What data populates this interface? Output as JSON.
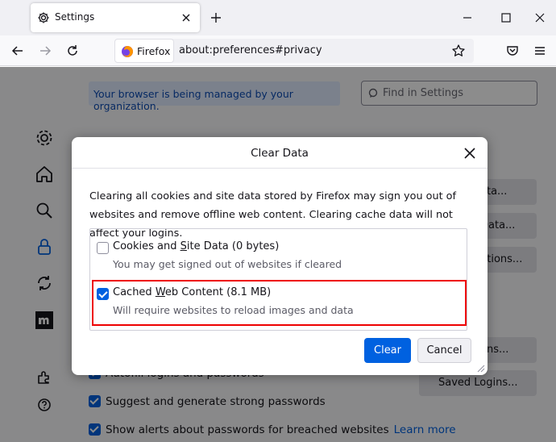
{
  "tab": {
    "title": "Settings",
    "icon": "gear-icon"
  },
  "window_controls": [
    "minimize-icon",
    "maximize-icon",
    "close-icon"
  ],
  "nav": {
    "identity_label": "Firefox",
    "url": "about:preferences#privacy"
  },
  "page": {
    "managed_notice": "Your browser is being managed by your organization.",
    "find_placeholder": "Find in Settings",
    "sidebar_icons": [
      "gear-icon",
      "home-icon",
      "search-icon",
      "lock-icon",
      "sync-icon",
      "mozilla-icon",
      "extensions-icon",
      "help-icon"
    ],
    "right_buttons": [
      "ata...",
      "Data...",
      "ptions...",
      "ons...",
      "Saved Logins..."
    ],
    "checkbox_rows": [
      {
        "label": "Autofill logins and passwords"
      },
      {
        "label": "Suggest and generate strong passwords"
      },
      {
        "label": "Show alerts about passwords for breached websites",
        "link": "Learn more"
      }
    ]
  },
  "dialog": {
    "title": "Clear Data",
    "description": "Clearing all cookies and site data stored by Firefox may sign you out of websites and remove offline web content. Clearing cache data will not affect your logins.",
    "options": [
      {
        "label_pre": "Cookies and ",
        "label_u": "S",
        "label_post": "ite Data (0 bytes)",
        "description": "You may get signed out of websites if cleared",
        "checked": false
      },
      {
        "label_pre": "Cached ",
        "label_u": "W",
        "label_post": "eb Content (8.1 MB)",
        "description": "Will require websites to reload images and data",
        "checked": true
      }
    ],
    "clear_button": "Clear",
    "cancel_button": "Cancel"
  },
  "colors": {
    "accent": "#0061e0",
    "highlight": "#ee0000"
  }
}
